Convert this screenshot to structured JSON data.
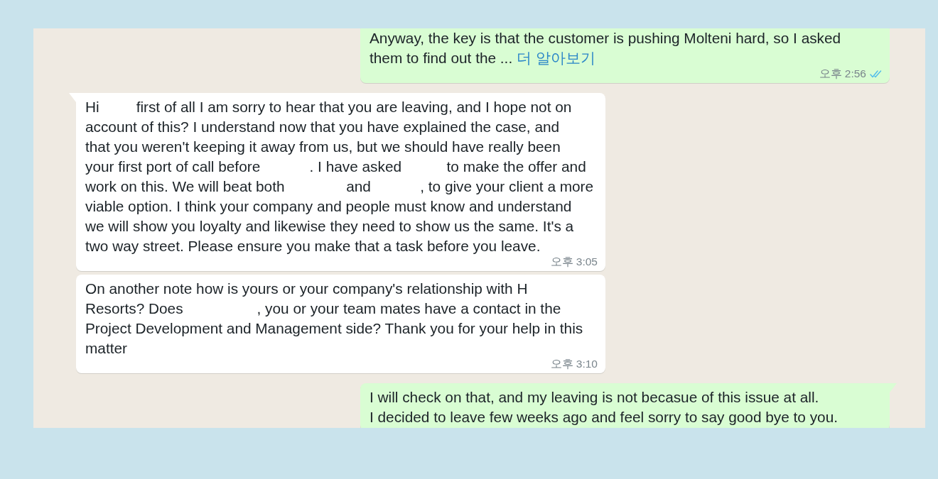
{
  "chat": {
    "messages": [
      {
        "kind": "outgoing",
        "tail": false,
        "text": "Anyway, the key is that the customer is pushing Molteni hard, so I asked\nthem to find out the ...",
        "link": "더 알아보기",
        "time": "오후 2:56",
        "read": true
      },
      {
        "kind": "incoming",
        "tail": true,
        "text": "Hi         first of all I am sorry to hear that you are leaving, and I hope not on\naccount of this? I understand now that you have explained the case, and\nthat you weren't keeping it away from us, but we should have really been\nyour first port of call before            . I have asked           to make the offer and\nwork on this. We will beat both               and            , to give your client a more\nviable option. I think your company and people must know and understand\nwe will show you loyalty and likewise they need to show us the same. It's a\ntwo way street. Please ensure you make that a task before you leave.",
        "time": "오후 3:05"
      },
      {
        "kind": "incoming",
        "tail": false,
        "text": "On another note how is yours or your company's relationship with H\nResorts? Does                  , you or your team mates have a contact in the\nProject Development and Management side? Thank you for your help in this\nmatter",
        "time": "오후 3:10"
      },
      {
        "kind": "outgoing",
        "tail": true,
        "text": "I will check on that, and my leaving is not becasue of this issue at all.\nI decided to leave few weeks ago and feel sorry to say good bye to you."
      }
    ]
  }
}
